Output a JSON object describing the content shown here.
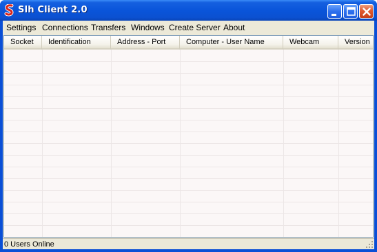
{
  "window": {
    "title": "Slh Client 2.0",
    "title_color": "#ffffff",
    "titlebar_color": "#0a55da"
  },
  "titlebar_buttons": {
    "minimize": "minimize-icon",
    "maximize": "maximize-icon",
    "close": "close-icon"
  },
  "menu": {
    "items": [
      "Settings",
      "Connections",
      "Transfers",
      "Windows",
      "Create Server",
      "About"
    ]
  },
  "table": {
    "columns": [
      "Socket",
      "Identification",
      "Address - Port",
      "Computer - User Name",
      "Webcam",
      "Version"
    ],
    "rows": []
  },
  "status": {
    "text": "0 Users Online"
  }
}
